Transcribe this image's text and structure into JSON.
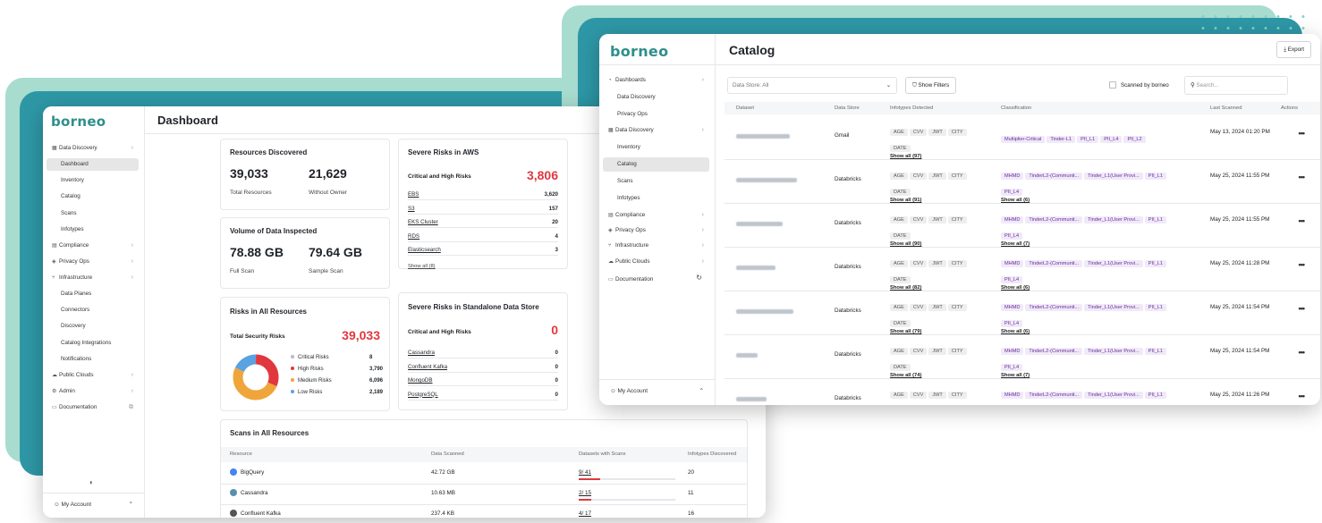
{
  "colors": {
    "brand": "#2f8f8a",
    "accent_teal": "#2e97a6",
    "accent_mint": "#a8dccf",
    "risk_red": "#e0383e",
    "tag_purple": "#6a2c9a"
  },
  "dashboard": {
    "logo": "borneo",
    "title": "Dashboard",
    "sidebar": [
      {
        "label": "Data Discovery",
        "icon": "grid-icon"
      },
      {
        "label": "Dashboard",
        "active": true
      },
      {
        "label": "Inventory"
      },
      {
        "label": "Catalog"
      },
      {
        "label": "Scans"
      },
      {
        "label": "Infotypes"
      },
      {
        "label": "Compliance",
        "icon": "clipboard-icon"
      },
      {
        "label": "Privacy Ops",
        "icon": "shield-icon"
      },
      {
        "label": "Infrastructure",
        "icon": "branch-icon"
      },
      {
        "label": "Data Planes"
      },
      {
        "label": "Connectors"
      },
      {
        "label": "Discovery"
      },
      {
        "label": "Catalog Integrations"
      },
      {
        "label": "Notifications"
      },
      {
        "label": "Public Clouds",
        "icon": "cloud-icon"
      },
      {
        "label": "Admin",
        "icon": "gear-icon"
      },
      {
        "label": "Documentation",
        "icon": "doc-icon"
      }
    ],
    "account": "My Account",
    "resources_discovered": {
      "title": "Resources Discovered",
      "total": "39,033",
      "total_label": "Total Resources",
      "without_owner": "21,629",
      "without_owner_label": "Without Owner"
    },
    "volume": {
      "title": "Volume of Data Inspected",
      "full": "78.88 GB",
      "full_label": "Full Scan",
      "sample": "79.64 GB",
      "sample_label": "Sample Scan"
    },
    "risks_all": {
      "title": "Risks in All Resources",
      "sub": "Total Security Risks",
      "total": "39,033",
      "legend": [
        {
          "label": "Critical Risks",
          "value": "8",
          "color": "#b8bcc2"
        },
        {
          "label": "High Risks",
          "value": "3,790",
          "color": "#e0383e"
        },
        {
          "label": "Medium Risks",
          "value": "6,096",
          "color": "#f0a53a"
        },
        {
          "label": "Low Risks",
          "value": "2,189",
          "color": "#5aa2e0"
        }
      ]
    },
    "aws": {
      "title": "Severe Risks in AWS",
      "sub": "Critical and High Risks",
      "total": "3,806",
      "rows": [
        {
          "name": "EBS",
          "value": "3,620"
        },
        {
          "name": "S3",
          "value": "157"
        },
        {
          "name": "EKS Cluster",
          "value": "20"
        },
        {
          "name": "RDS",
          "value": "4"
        },
        {
          "name": "Elasticsearch",
          "value": "3"
        }
      ],
      "show_all": "Show all (8)"
    },
    "standalone": {
      "title": "Severe Risks in Standalone Data Store",
      "sub": "Critical and High Risks",
      "total": "0",
      "rows": [
        {
          "name": "Cassandra",
          "value": "0"
        },
        {
          "name": "Confluent Kafka",
          "value": "0"
        },
        {
          "name": "MongoDB",
          "value": "0"
        },
        {
          "name": "PostgreSQL",
          "value": "0"
        }
      ]
    },
    "scans": {
      "title": "Scans in All Resources",
      "headers": [
        "Resource",
        "Data Scanned",
        "Datasets with Scans",
        "Infotypes Discovered"
      ],
      "rows": [
        {
          "name": "BigQuery",
          "scanned": "42.72 GB",
          "datasets": "9/ 41",
          "infotypes": "20",
          "progress": 0.22
        },
        {
          "name": "Cassandra",
          "scanned": "10.63 MB",
          "datasets": "2/ 15",
          "infotypes": "11",
          "progress": 0.13
        },
        {
          "name": "Confluent Kafka",
          "scanned": "237.4 KB",
          "datasets": "4/ 17",
          "infotypes": "16",
          "progress": 0.24
        }
      ]
    }
  },
  "catalog": {
    "logo": "borneo",
    "title": "Catalog",
    "export_label": "Export",
    "sidebar": [
      {
        "label": "Dashboards",
        "icon": "gauge-icon"
      },
      {
        "label": "Data Discovery"
      },
      {
        "label": "Privacy Ops"
      },
      {
        "label": "Data Discovery",
        "icon": "grid-icon"
      },
      {
        "label": "Inventory"
      },
      {
        "label": "Catalog",
        "active": true
      },
      {
        "label": "Scans"
      },
      {
        "label": "Infotypes"
      },
      {
        "label": "Compliance",
        "icon": "clipboard-icon"
      },
      {
        "label": "Privacy Ops",
        "icon": "shield-icon"
      },
      {
        "label": "Infrastructure",
        "icon": "branch-icon"
      },
      {
        "label": "Public Clouds",
        "icon": "cloud-icon"
      },
      {
        "label": "Documentation",
        "icon": "doc-icon"
      }
    ],
    "account": "My Account",
    "filter": {
      "data_store": "Data Store: All",
      "show_filters": "Show Filters",
      "scanned_by": "Scanned by borneo",
      "search_placeholder": "Search..."
    },
    "headers": [
      "Dataset",
      "Data Store",
      "Infotypes Detected",
      "Classification",
      "Last Scanned",
      "Actions"
    ],
    "rows": [
      {
        "store": "Gmail",
        "infotypes": [
          "AGE",
          "CVV",
          "JWT",
          "CITY",
          "DATE"
        ],
        "show_all": "Show all (97)",
        "classes": [
          "Multiplier-Critical",
          "Tinder-L1",
          "PII_L1",
          "PII_L4",
          "PII_L2"
        ],
        "class_show": "",
        "scanned": "May 13, 2024 01:20 PM"
      },
      {
        "store": "Databricks",
        "infotypes": [
          "AGE",
          "CVV",
          "JWT",
          "CITY",
          "DATE"
        ],
        "show_all": "Show all (91)",
        "classes": [
          "MHMD",
          "TinderL2-(Communit...",
          "Tinder_L1(User Provi...",
          "PII_L1",
          "PII_L4"
        ],
        "class_show": "Show all (6)",
        "scanned": "May 25, 2024 11:55 PM"
      },
      {
        "store": "Databricks",
        "infotypes": [
          "AGE",
          "CVV",
          "JWT",
          "CITY",
          "DATE"
        ],
        "show_all": "Show all (90)",
        "classes": [
          "MHMD",
          "TinderL2-(Communit...",
          "Tinder_L1(User Provi...",
          "PII_L1",
          "PII_L4"
        ],
        "class_show": "Show all (7)",
        "scanned": "May 25, 2024 11:55 PM"
      },
      {
        "store": "Databricks",
        "infotypes": [
          "AGE",
          "CVV",
          "JWT",
          "CITY",
          "DATE"
        ],
        "show_all": "Show all (82)",
        "classes": [
          "MHMD",
          "TinderL2-(Communit...",
          "Tinder_L1(User Provi...",
          "PII_L1",
          "PII_L4"
        ],
        "class_show": "Show all (6)",
        "scanned": "May 25, 2024 11:28 PM"
      },
      {
        "store": "Databricks",
        "infotypes": [
          "AGE",
          "CVV",
          "JWT",
          "CITY",
          "DATE"
        ],
        "show_all": "Show all (79)",
        "classes": [
          "MHMD",
          "TinderL2-(Communit...",
          "Tinder_L1(User Provi...",
          "PII_L1",
          "PII_L4"
        ],
        "class_show": "Show all (6)",
        "scanned": "May 25, 2024 11:54 PM"
      },
      {
        "store": "Databricks",
        "infotypes": [
          "AGE",
          "CVV",
          "JWT",
          "CITY",
          "DATE"
        ],
        "show_all": "Show all (74)",
        "classes": [
          "MHMD",
          "TinderL2-(Communit...",
          "Tinder_L1(User Provi...",
          "PII_L1",
          "PII_L4"
        ],
        "class_show": "Show all (7)",
        "scanned": "May 25, 2024 11:54 PM"
      },
      {
        "store": "Databricks",
        "infotypes": [
          "AGE",
          "CVV",
          "JWT",
          "CITY",
          "DATE"
        ],
        "show_all": "",
        "classes": [
          "MHMD",
          "TinderL2-(Communit...",
          "Tinder_L1(User Provi...",
          "PII_L1",
          "PII_L2"
        ],
        "class_show": "",
        "scanned": "May 25, 2024 11:26 PM"
      }
    ]
  }
}
